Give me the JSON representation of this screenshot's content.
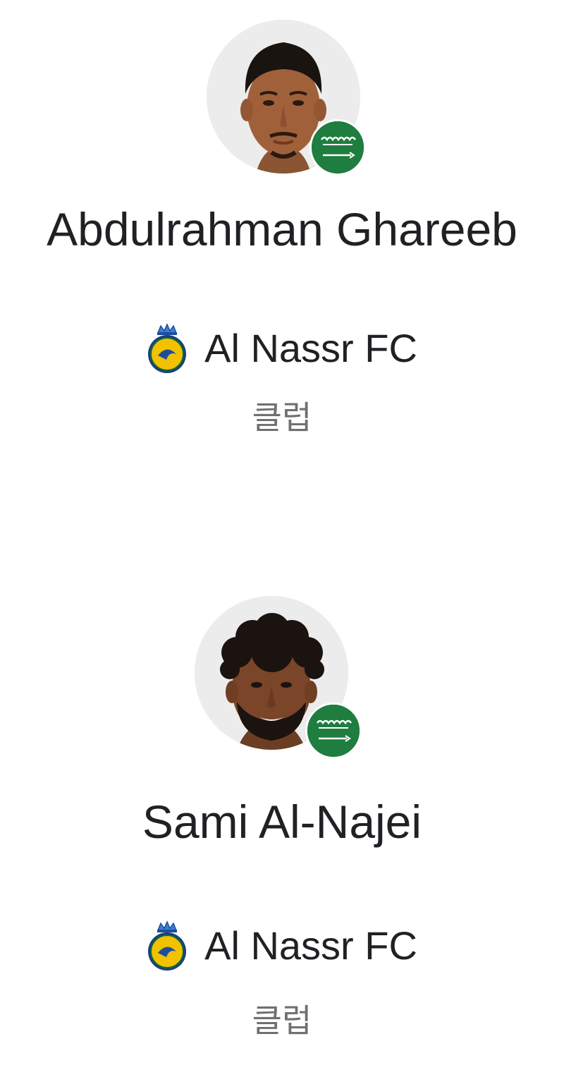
{
  "players": [
    {
      "name": "Abdulrahman Ghareeb",
      "nationality_icon": "saudi-arabia-flag-icon",
      "club": {
        "name": "Al Nassr FC",
        "logo_icon": "al-nassr-crest-icon"
      },
      "role": "클럽"
    },
    {
      "name": "Sami Al-Najei",
      "nationality_icon": "saudi-arabia-flag-icon",
      "club": {
        "name": "Al Nassr FC",
        "logo_icon": "al-nassr-crest-icon"
      },
      "role": "클럽"
    }
  ],
  "colors": {
    "flag_green": "#1e7d3f",
    "club_yellow": "#f2c200",
    "club_blue": "#1b4f9c",
    "avatar_bg": "#ececec",
    "text": "#202124",
    "muted_text": "#707070"
  }
}
